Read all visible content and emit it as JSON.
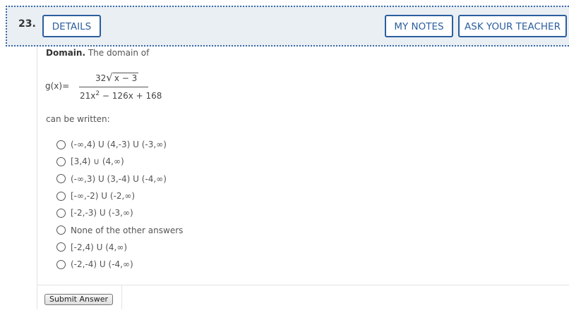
{
  "header": {
    "question_number": "23.",
    "details_label": "DETAILS",
    "my_notes_label": "MY NOTES",
    "ask_teacher_label": "ASK YOUR TEACHER"
  },
  "problem": {
    "domain_bold": "Domain.",
    "domain_text": " The domain of",
    "function_name": "g(x)=",
    "numerator_coef": "32",
    "radicand": "x − 3",
    "denominator_a": "21x",
    "denominator_exp": "2",
    "denominator_rest": " − 126x + 168",
    "can_be_written": "can be written:"
  },
  "options": [
    {
      "label": "(-∞,4) U (4,-3) U (-3,∞)"
    },
    {
      "label": "[3,4) ∪ (4,∞)"
    },
    {
      "label": "(-∞,3) U (3,-4) U (-4,∞)"
    },
    {
      "label": "[-∞,-2) U (-2,∞)"
    },
    {
      "label": "[-2,-3) U (-3,∞)"
    },
    {
      "label": "None of the other answers"
    },
    {
      "label": "[-2,4) U (4,∞)"
    },
    {
      "label": "(-2,-4) U (-4,∞)"
    }
  ],
  "submit": {
    "label": "Submit Answer"
  }
}
